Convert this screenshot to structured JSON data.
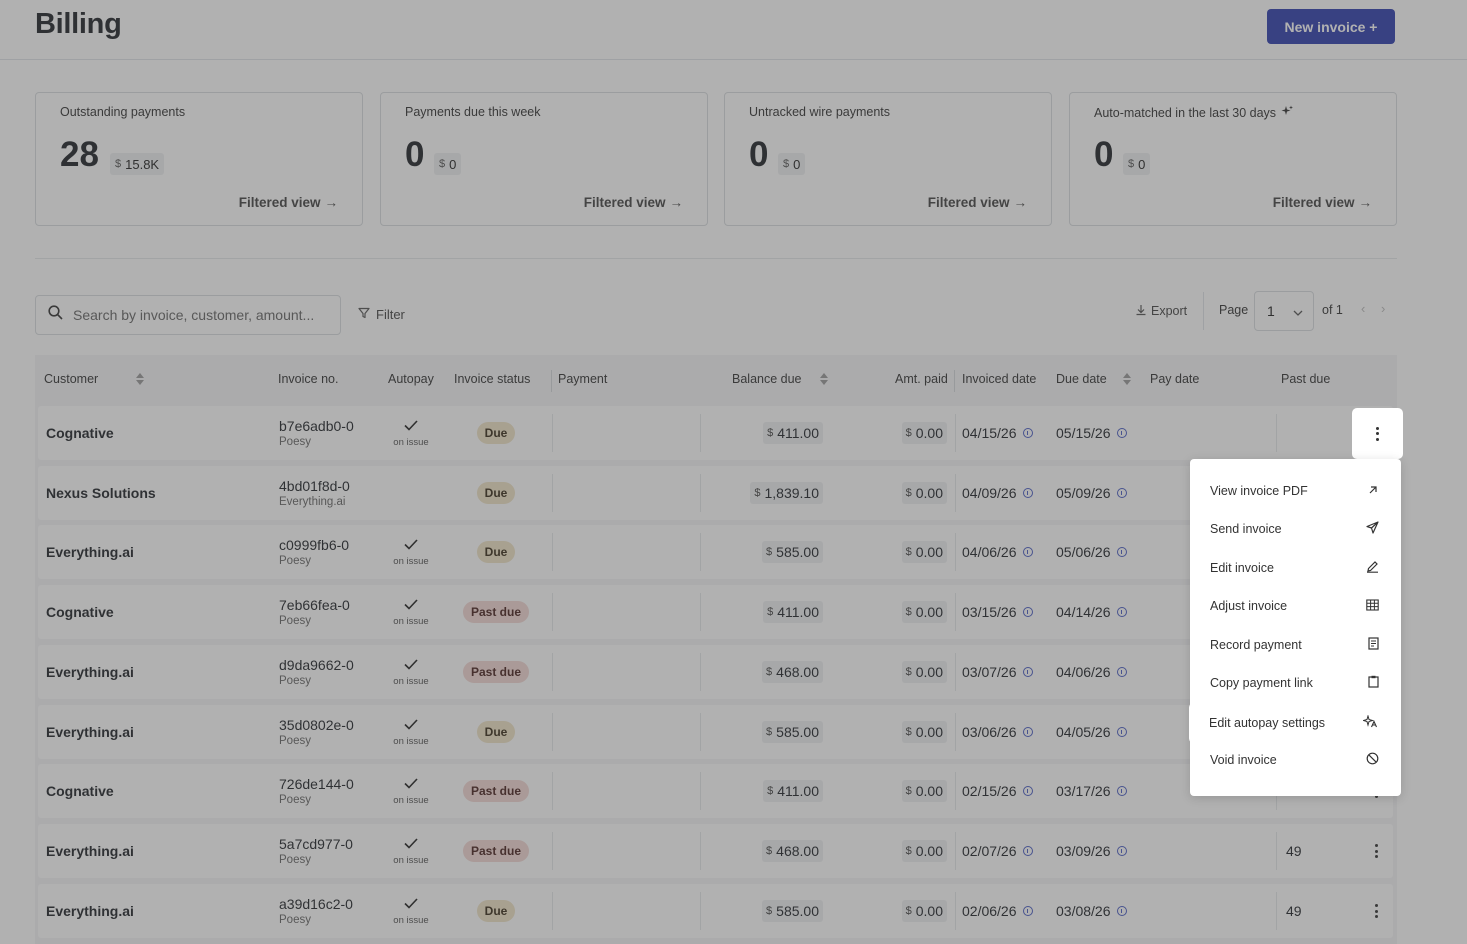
{
  "header": {
    "title": "Billing",
    "new_invoice_label": "New invoice +"
  },
  "cards": [
    {
      "title": "Outstanding payments",
      "value": "28",
      "currency": "$",
      "amount": "15.8K",
      "link": "Filtered view"
    },
    {
      "title": "Payments due this week",
      "value": "0",
      "currency": "$",
      "amount": "0",
      "link": "Filtered view"
    },
    {
      "title": "Untracked wire payments",
      "value": "0",
      "currency": "$",
      "amount": "0",
      "link": "Filtered view"
    },
    {
      "title": "Auto-matched in the last 30 days",
      "value": "0",
      "currency": "$",
      "amount": "0",
      "link": "Filtered view"
    }
  ],
  "toolbar": {
    "search_placeholder": "Search by invoice, customer, amount...",
    "filter_label": "Filter",
    "export_label": "Export",
    "page_label": "Page",
    "page_value": "1",
    "page_of": "of 1"
  },
  "table": {
    "columns": {
      "customer": "Customer",
      "invoice_no": "Invoice no.",
      "autopay": "Autopay",
      "invoice_status": "Invoice status",
      "payment": "Payment",
      "balance_due": "Balance due",
      "amt_paid": "Amt. paid",
      "invoiced_date": "Invoiced date",
      "due_date": "Due date",
      "pay_date": "Pay date",
      "past_due": "Past due"
    },
    "rows": [
      {
        "customer": "Cognative",
        "invoice_no": "b7e6adb0-0",
        "sub": "Poesy",
        "autopay": "on issue",
        "status": "Due",
        "balance": "411.00",
        "paid": "0.00",
        "invoiced": "04/15/26",
        "due": "05/15/26",
        "past_due": ""
      },
      {
        "customer": "Nexus Solutions",
        "invoice_no": "4bd01f8d-0",
        "sub": "Everything.ai",
        "autopay": "",
        "status": "Due",
        "balance": "1,839.10",
        "paid": "0.00",
        "invoiced": "04/09/26",
        "due": "05/09/26",
        "past_due": ""
      },
      {
        "customer": "Everything.ai",
        "invoice_no": "c0999fb6-0",
        "sub": "Poesy",
        "autopay": "on issue",
        "status": "Due",
        "balance": "585.00",
        "paid": "0.00",
        "invoiced": "04/06/26",
        "due": "05/06/26",
        "past_due": ""
      },
      {
        "customer": "Cognative",
        "invoice_no": "7eb66fea-0",
        "sub": "Poesy",
        "autopay": "on issue",
        "status": "Past due",
        "balance": "411.00",
        "paid": "0.00",
        "invoiced": "03/15/26",
        "due": "04/14/26",
        "past_due": ""
      },
      {
        "customer": "Everything.ai",
        "invoice_no": "d9da9662-0",
        "sub": "Poesy",
        "autopay": "on issue",
        "status": "Past due",
        "balance": "468.00",
        "paid": "0.00",
        "invoiced": "03/07/26",
        "due": "04/06/26",
        "past_due": ""
      },
      {
        "customer": "Everything.ai",
        "invoice_no": "35d0802e-0",
        "sub": "Poesy",
        "autopay": "on issue",
        "status": "Due",
        "balance": "585.00",
        "paid": "0.00",
        "invoiced": "03/06/26",
        "due": "04/05/26",
        "past_due": ""
      },
      {
        "customer": "Cognative",
        "invoice_no": "726de144-0",
        "sub": "Poesy",
        "autopay": "on issue",
        "status": "Past due",
        "balance": "411.00",
        "paid": "0.00",
        "invoiced": "02/15/26",
        "due": "03/17/26",
        "past_due": ""
      },
      {
        "customer": "Everything.ai",
        "invoice_no": "5a7cd977-0",
        "sub": "Poesy",
        "autopay": "on issue",
        "status": "Past due",
        "balance": "468.00",
        "paid": "0.00",
        "invoiced": "02/07/26",
        "due": "03/09/26",
        "past_due": "49"
      },
      {
        "customer": "Everything.ai",
        "invoice_no": "a39d16c2-0",
        "sub": "Poesy",
        "autopay": "on issue",
        "status": "Due",
        "balance": "585.00",
        "paid": "0.00",
        "invoiced": "02/06/26",
        "due": "03/08/26",
        "past_due": "49"
      }
    ],
    "currency": "$"
  },
  "menu": {
    "items": [
      {
        "label": "View invoice PDF",
        "icon": "arrow-up-right-icon"
      },
      {
        "label": "Send invoice",
        "icon": "send-icon"
      },
      {
        "label": "Edit invoice",
        "icon": "pencil-icon"
      },
      {
        "label": "Adjust invoice",
        "icon": "table-icon"
      },
      {
        "label": "Record payment",
        "icon": "receipt-icon"
      },
      {
        "label": "Copy payment link",
        "icon": "clipboard-icon"
      },
      {
        "label": "Edit autopay settings",
        "icon": "autopay-icon"
      },
      {
        "label": "Void invoice",
        "icon": "void-icon"
      }
    ],
    "highlighted": "Edit autopay settings"
  },
  "colors": {
    "primary": "#2f3fae",
    "due_badge": "#efe3c6",
    "past_due_badge": "#f3d7d4",
    "info_icon": "#4b5ec4"
  }
}
